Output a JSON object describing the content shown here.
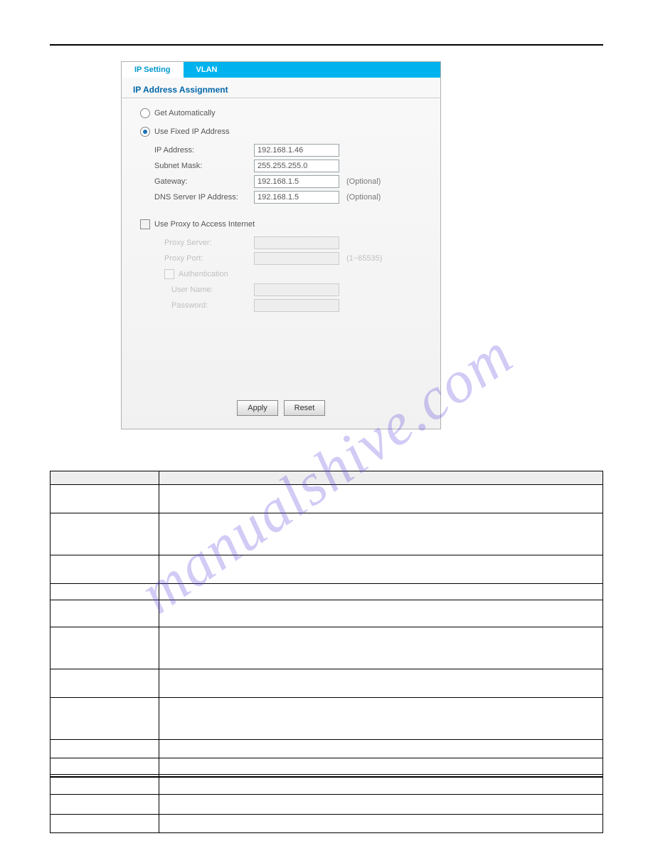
{
  "tabs": {
    "active": "IP Setting",
    "inactive": "VLAN"
  },
  "section_title": "IP Address Assignment",
  "radios": {
    "auto": "Get Automatically",
    "fixed": "Use Fixed IP Address"
  },
  "fields": {
    "ip_label": "IP Address:",
    "ip_value": "192.168.1.46",
    "mask_label": "Subnet Mask:",
    "mask_value": "255.255.255.0",
    "gw_label": "Gateway:",
    "gw_value": "192.168.1.5",
    "gw_hint": "(Optional)",
    "dns_label": "DNS Server IP Address:",
    "dns_value": "192.168.1.5",
    "dns_hint": "(Optional)"
  },
  "proxy": {
    "use_label": "Use Proxy to Access Internet",
    "server_label": "Proxy Server:",
    "port_label": "Proxy Port:",
    "port_hint": "(1~65535)",
    "auth_label": "Authentication",
    "user_label": "User Name:",
    "pwd_label": "Password:"
  },
  "buttons": {
    "apply": "Apply",
    "reset": "Reset"
  },
  "table_heights": [
    18,
    39,
    58,
    39,
    22,
    37,
    58,
    39,
    58,
    25,
    22,
    27,
    27,
    25
  ],
  "watermark": "manualshive.com"
}
